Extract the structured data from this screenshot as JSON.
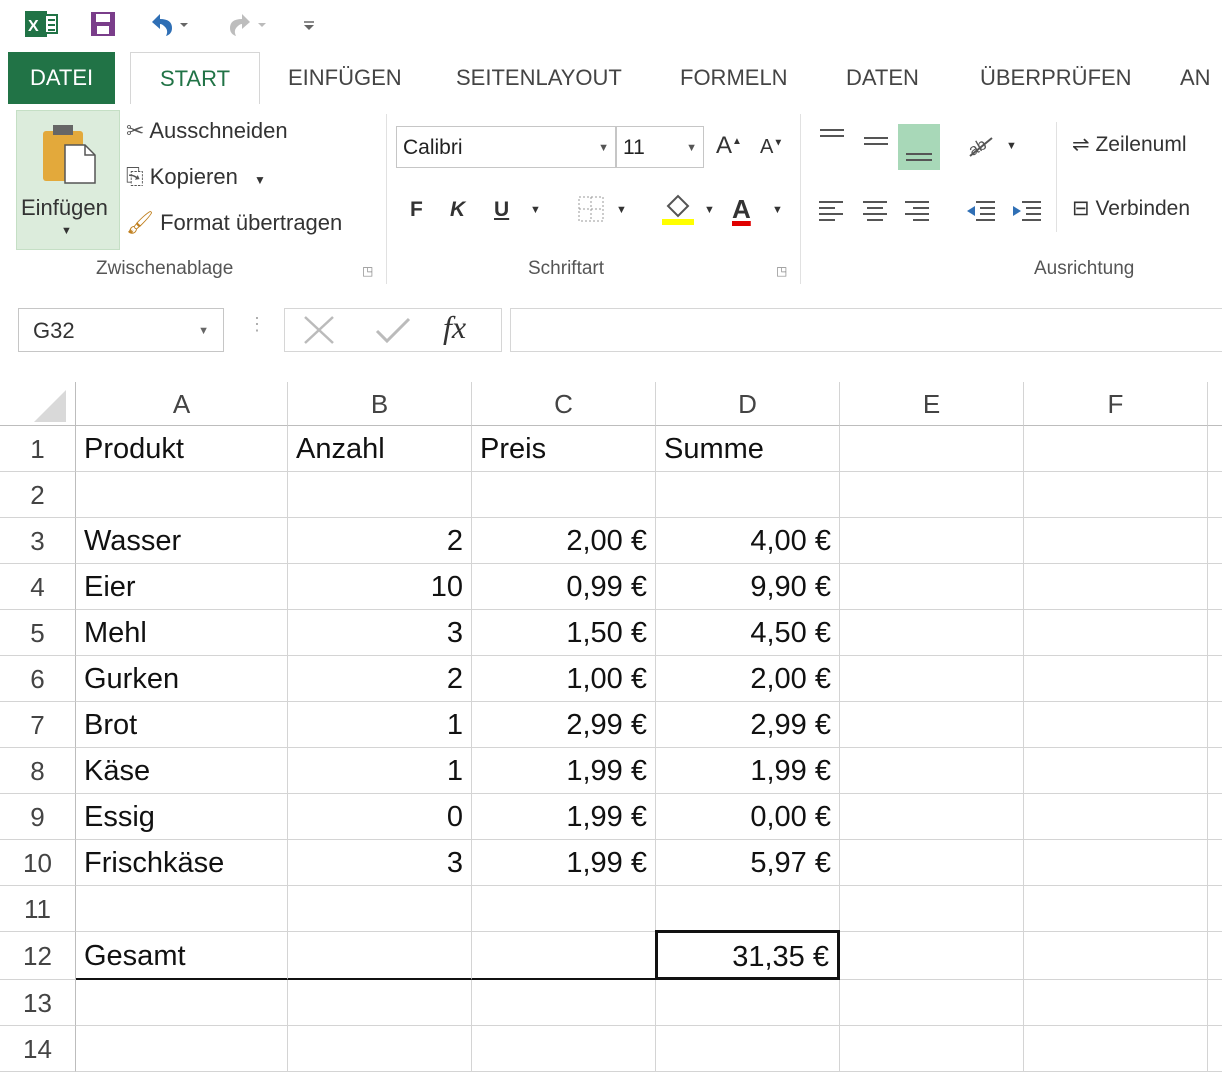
{
  "quick_access": {
    "excel_icon": "excel-icon",
    "save_icon": "save-icon",
    "undo_icon": "undo-icon",
    "redo_icon": "redo-icon",
    "customize_icon": "customize-icon"
  },
  "tabs": [
    "DATEI",
    "START",
    "EINFÜGEN",
    "SEITENLAYOUT",
    "FORMELN",
    "DATEN",
    "ÜBERPRÜFEN",
    "AN"
  ],
  "ribbon": {
    "clipboard": {
      "paste": "Einfügen",
      "cut": "Ausschneiden",
      "copy": "Kopieren",
      "format_painter": "Format übertragen",
      "label": "Zwischenablage"
    },
    "font": {
      "font_name": "Calibri",
      "font_size": "11",
      "bold": "F",
      "italic": "K",
      "underline": "U",
      "grow": "A",
      "shrink": "A",
      "font_color": "A",
      "label": "Schriftart"
    },
    "alignment": {
      "wrap": "Zeilenuml",
      "merge": "Verbinden",
      "label": "Ausrichtung"
    }
  },
  "formula_bar": {
    "name_box": "G32",
    "fx": "fx",
    "formula": ""
  },
  "columns": [
    "A",
    "B",
    "C",
    "D",
    "E",
    "F"
  ],
  "rows": [
    {
      "n": "1",
      "cells": [
        "Produkt",
        "Anzahl",
        "Preis",
        "Summe"
      ]
    },
    {
      "n": "2",
      "cells": [
        "",
        "",
        "",
        ""
      ]
    },
    {
      "n": "3",
      "cells": [
        "Wasser",
        "2",
        "2,00 €",
        "4,00 €"
      ]
    },
    {
      "n": "4",
      "cells": [
        "Eier",
        "10",
        "0,99 €",
        "9,90 €"
      ]
    },
    {
      "n": "5",
      "cells": [
        "Mehl",
        "3",
        "1,50 €",
        "4,50 €"
      ]
    },
    {
      "n": "6",
      "cells": [
        "Gurken",
        "2",
        "1,00 €",
        "2,00 €"
      ]
    },
    {
      "n": "7",
      "cells": [
        "Brot",
        "1",
        "2,99 €",
        "2,99 €"
      ]
    },
    {
      "n": "8",
      "cells": [
        "Käse",
        "1",
        "1,99 €",
        "1,99 €"
      ]
    },
    {
      "n": "9",
      "cells": [
        "Essig",
        "0",
        "1,99 €",
        "0,00 €"
      ]
    },
    {
      "n": "10",
      "cells": [
        "Frischkäse",
        "3",
        "1,99 €",
        "5,97 €"
      ]
    },
    {
      "n": "11",
      "cells": [
        "",
        "",
        "",
        ""
      ]
    },
    {
      "n": "12",
      "cells": [
        "Gesamt",
        "",
        "",
        "31,35 €"
      ]
    },
    {
      "n": "13",
      "cells": [
        "",
        "",
        "",
        ""
      ]
    },
    {
      "n": "14",
      "cells": [
        "",
        "",
        "",
        ""
      ]
    }
  ],
  "colors": {
    "excel_green": "#217346",
    "highlight_yellow": "#ffff00",
    "font_red": "#e00000"
  }
}
